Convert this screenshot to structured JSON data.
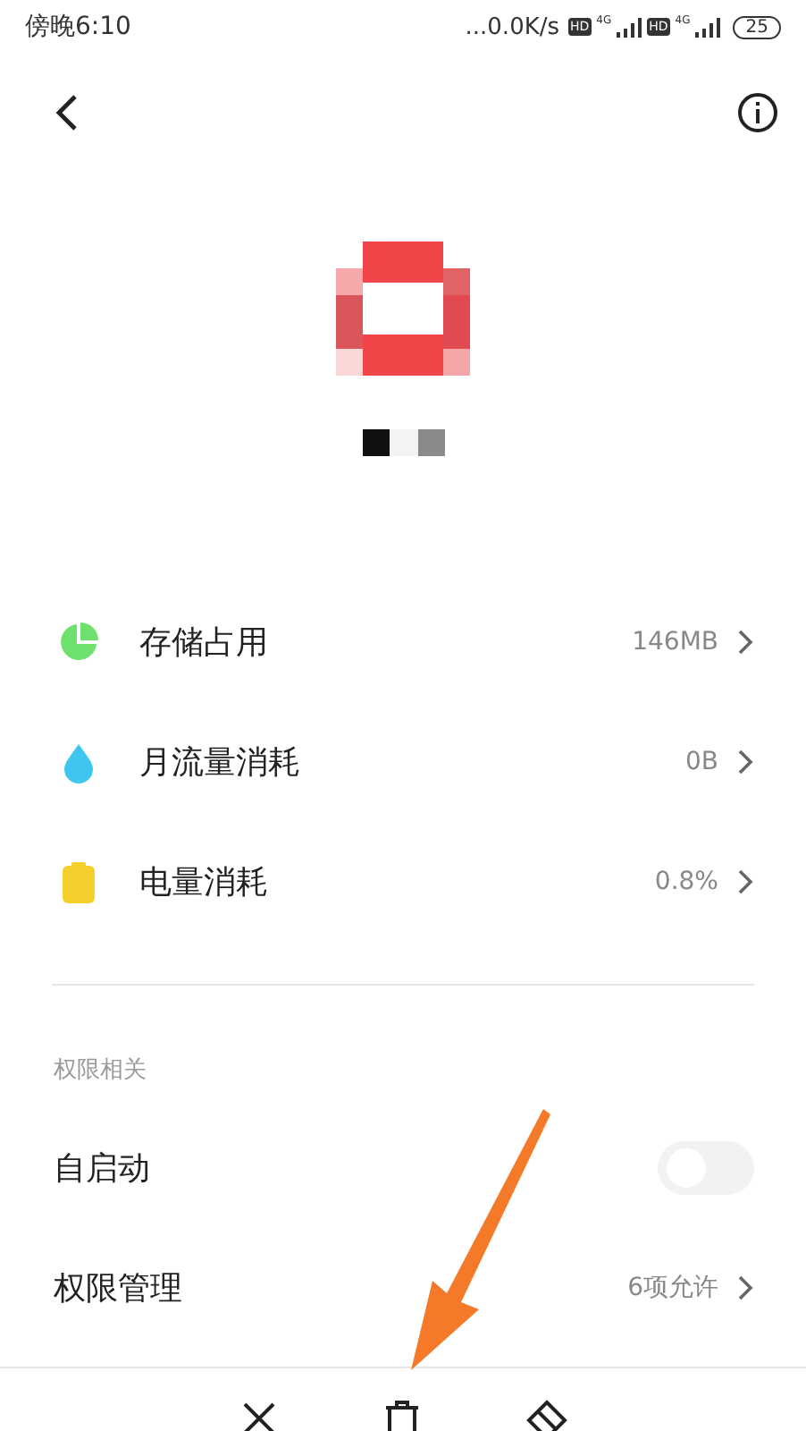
{
  "status_bar": {
    "time": "傍晚6:10",
    "network_speed": "...0.0K/s",
    "sims": [
      {
        "hd": "HD",
        "network": "4G"
      },
      {
        "hd": "HD",
        "network": "4G"
      }
    ],
    "battery": "25"
  },
  "usage_rows": [
    {
      "kind": "storage",
      "label": "存储占用",
      "value": "146MB"
    },
    {
      "kind": "data",
      "label": "月流量消耗",
      "value": "0B"
    },
    {
      "kind": "battery",
      "label": "电量消耗",
      "value": "0.8%"
    }
  ],
  "permissions": {
    "title": "权限相关",
    "items": [
      {
        "kind": "toggle",
        "label": "自启动",
        "on": false
      },
      {
        "kind": "link",
        "label": "权限管理",
        "value": "6项允许"
      }
    ]
  }
}
